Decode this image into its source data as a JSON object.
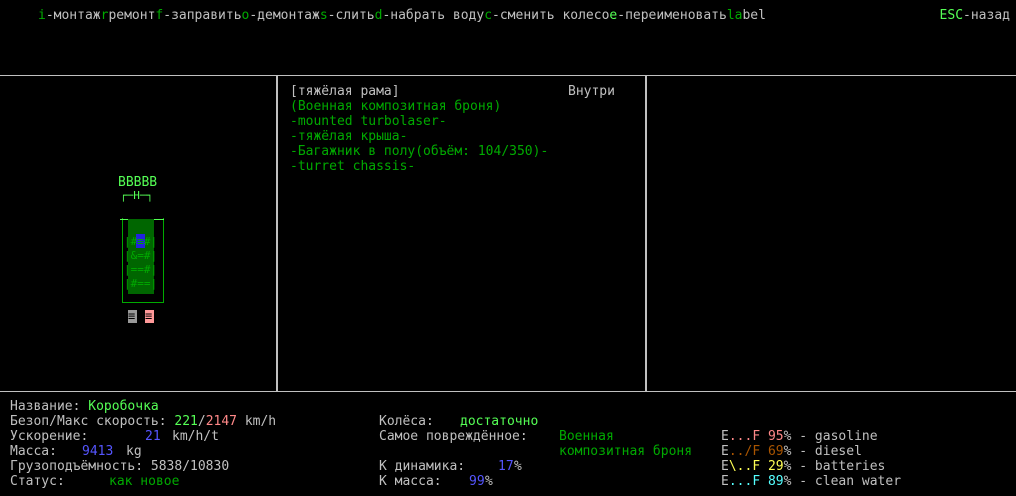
{
  "menu": {
    "items": [
      {
        "key": "i",
        "label": "-монтаж"
      },
      {
        "key": "r",
        "label": "ремонт"
      },
      {
        "key": "f",
        "label": "-заправить"
      },
      {
        "key": "o",
        "label": "-демонтаж"
      },
      {
        "key": "s",
        "label": "-слить"
      },
      {
        "key": "d",
        "label": "-набрать воду"
      },
      {
        "key": "c",
        "label": "-сменить колесо"
      },
      {
        "key": "e",
        "label": "-переименовать"
      },
      {
        "key": "la",
        "label": "bel"
      }
    ],
    "esc_key": "ESC",
    "esc_label": "-назад"
  },
  "vehicle_map": {
    "rows": [
      {
        "t": "BBBBB",
        "c": "lg"
      },
      {
        "t": "┌─H─┐",
        "c": "lg"
      },
      {
        "t": "",
        "c": "g"
      },
      {
        "t": "+##+",
        "c": "lg"
      },
      {
        "t": "|#≡#|",
        "c": "g"
      },
      {
        "t": "|&=#|",
        "c": "g"
      },
      {
        "t": "|==#|",
        "c": "g"
      },
      {
        "t": "|#==|",
        "c": "g"
      },
      {
        "t": "|   |",
        "c": "g"
      },
      {
        "t": "└─+─┘",
        "c": "g"
      }
    ],
    "wheels": [
      "≡",
      "≡"
    ]
  },
  "parts": {
    "header_location": "Внутри",
    "list": [
      {
        "text": "[тяжёлая рама]",
        "c": "gr"
      },
      {
        "text": "(Военная композитная броня)",
        "c": "g"
      },
      {
        "text": "-mounted turbolaser-",
        "c": "g"
      },
      {
        "text": "-тяжёлая крыша-",
        "c": "g"
      },
      {
        "text": "-Багажник в полу(объём: 104/350)-",
        "c": "g"
      },
      {
        "text": "-turret chassis-",
        "c": "g"
      }
    ]
  },
  "info": {
    "name_label": "Название:",
    "name_value": "Коробочка",
    "speed_label": "Безоп/Макс скорость:",
    "speed_safe": "221",
    "speed_sep": "/",
    "speed_max": "2147",
    "speed_unit": "km/h",
    "accel_label": "Ускорение:",
    "accel_value": "21",
    "accel_unit": "km/h/t",
    "mass_label": "Масса:",
    "mass_value": "9413",
    "mass_unit": "kg",
    "cargo_label": "Грузоподъёмность:",
    "cargo_value": "5838/10830",
    "status_label": "Статус:",
    "status_value": "как новое",
    "wheels_label": "Колёса:",
    "wheels_value": "достаточно",
    "damaged_label": "Самое повреждённое:",
    "damaged_value_1": "Военная",
    "damaged_value_2": "композитная броня",
    "dyn_label": "К динамика:",
    "dyn_value": "17",
    "dyn_unit": "%",
    "kmass_label": "К масса:",
    "kmass_value": "99",
    "kmass_unit": "%"
  },
  "fuel": [
    {
      "gauge_e": "E",
      "gauge_mid": "...",
      "gauge_f": "F",
      "pct": "95",
      "unit": "%",
      "name": "- gasoline",
      "color": "#ff8888",
      "pct_color": "#ff8888"
    },
    {
      "gauge_e": "E",
      "gauge_mid": "../",
      "gauge_f": "F",
      "pct": "69",
      "unit": "%",
      "name": "- diesel",
      "color": "#aa5500",
      "pct_color": "#aa5500"
    },
    {
      "gauge_e": "E",
      "gauge_mid": "\\..",
      "gauge_f": "F",
      "pct": "29",
      "unit": "%",
      "name": "- batteries",
      "color": "#ffff55",
      "pct_color": "#ffff55"
    },
    {
      "gauge_e": "E",
      "gauge_mid": "...",
      "gauge_f": "F",
      "pct": "89",
      "unit": "%",
      "name": "- clean water",
      "color": "#55ffff",
      "pct_color": "#55ffff"
    }
  ]
}
